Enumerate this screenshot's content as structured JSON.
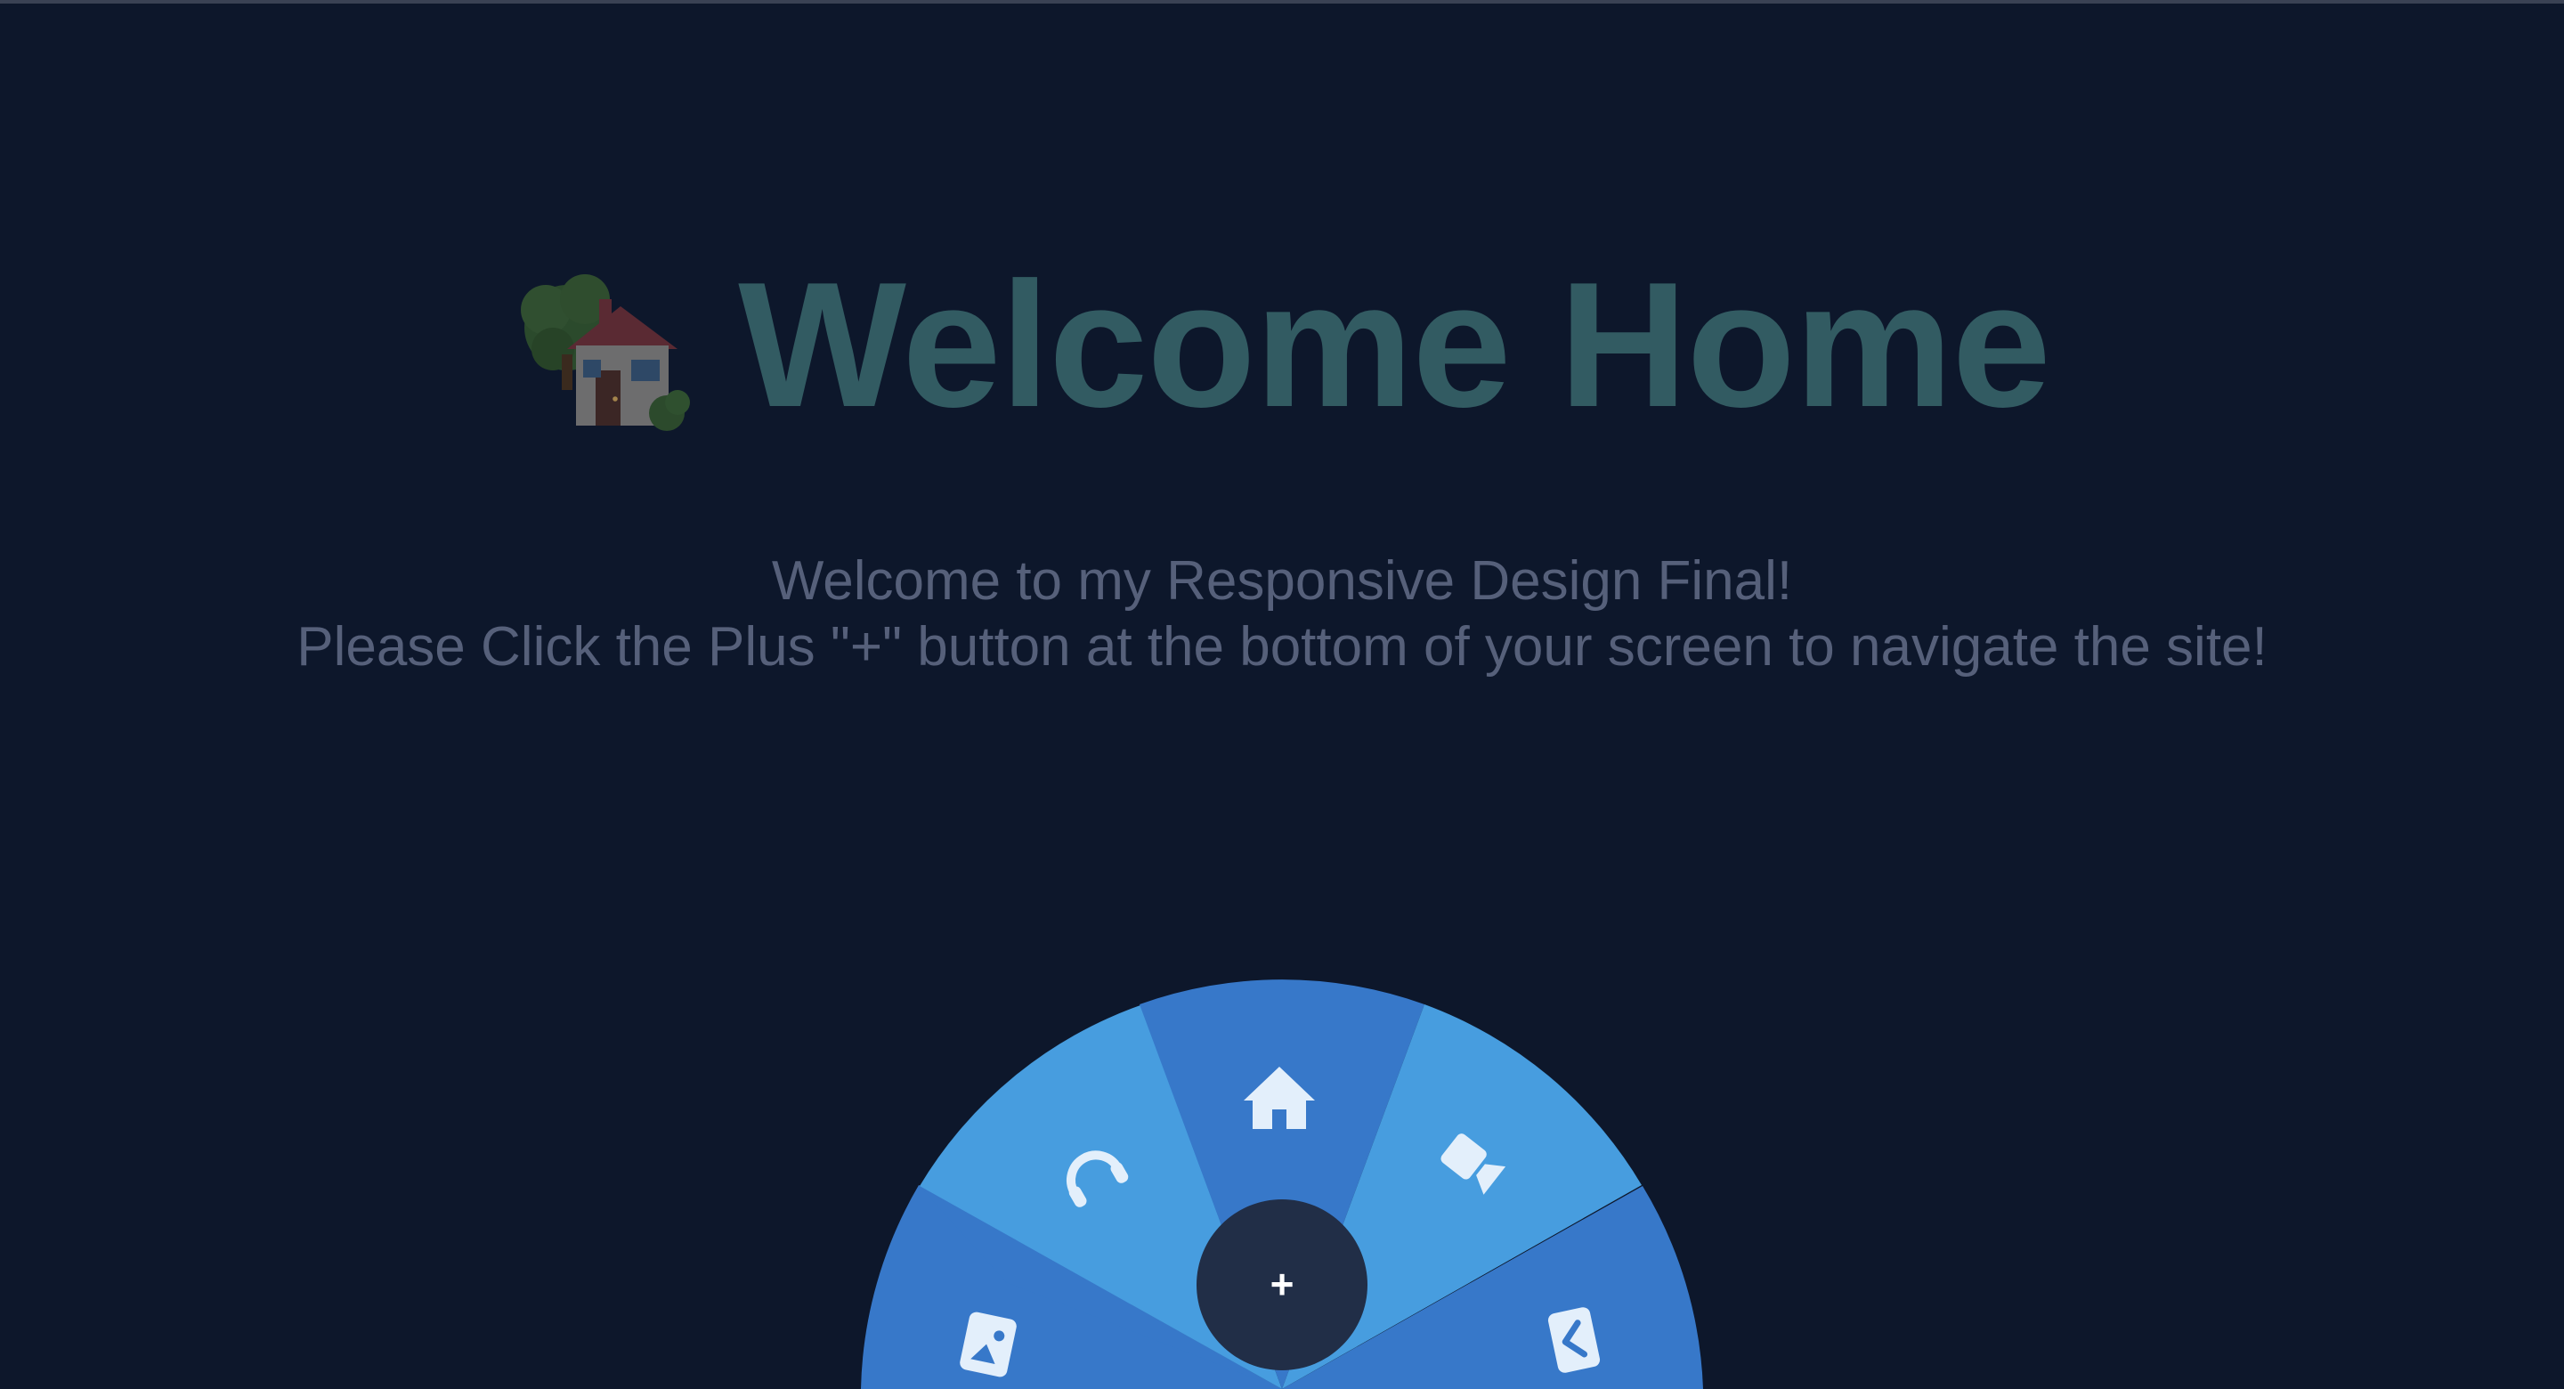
{
  "page": {
    "heading": {
      "icon": "house-with-garden-icon",
      "title": "Welcome Home"
    },
    "intro": {
      "line1": "Welcome to my Responsive Design Final!",
      "line2": "Please Click the Plus \"+\" button at the bottom of your screen to navigate the site!"
    }
  },
  "nav_menu": {
    "toggle_label": "+",
    "items": [
      {
        "icon": "image-card-icon"
      },
      {
        "icon": "headphones-icon"
      },
      {
        "icon": "home-icon"
      },
      {
        "icon": "video-camera-icon"
      },
      {
        "icon": "back-card-icon"
      }
    ]
  },
  "colors": {
    "background": "#0d172b",
    "title": "#325b62",
    "intro_text": "#56607a",
    "segment_dark": "#3778c9",
    "segment_light": "#479ddf",
    "center_button": "#212e47",
    "icon": "#e3effb"
  }
}
